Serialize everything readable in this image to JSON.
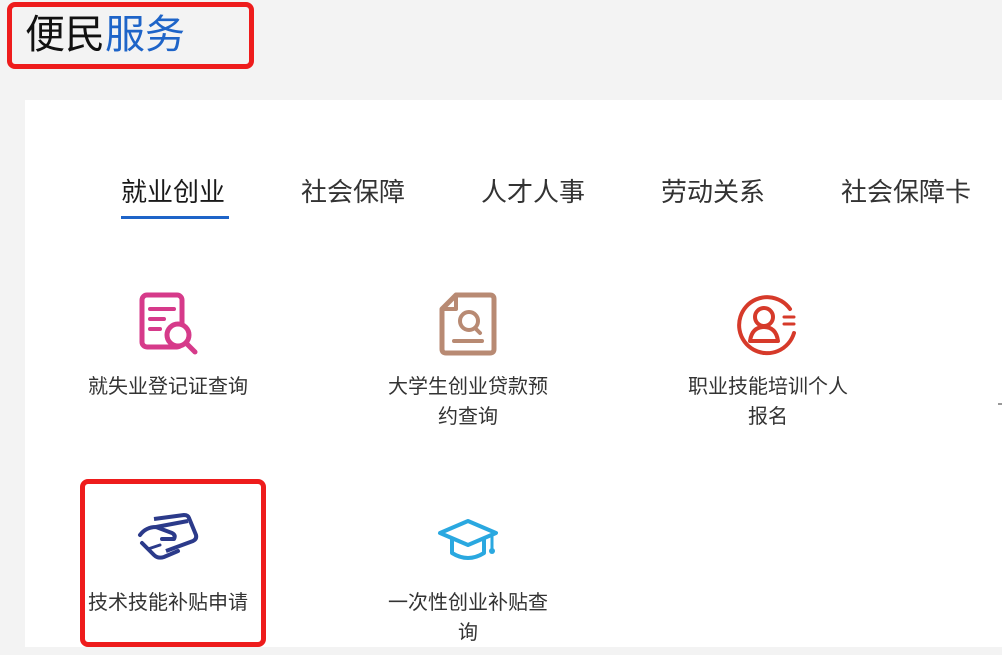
{
  "section": {
    "title_black": "便民",
    "title_blue": "服务"
  },
  "tabs": [
    {
      "label": "就业创业",
      "active": true
    },
    {
      "label": "社会保障",
      "active": false
    },
    {
      "label": "人才人事",
      "active": false
    },
    {
      "label": "劳动关系",
      "active": false
    },
    {
      "label": "社会保障卡",
      "active": false
    }
  ],
  "services": [
    {
      "label": "就失业登记证查询",
      "icon": "document-search-icon",
      "color": "#d63a8a"
    },
    {
      "label": "大学生创业贷款预约查询",
      "icon": "certificate-search-icon",
      "color": "#b88a73"
    },
    {
      "label": "职业技能培训个人报名",
      "icon": "person-list-icon",
      "color": "#d63a2a"
    },
    {
      "label": "技术技能补贴申请",
      "icon": "hand-card-icon",
      "color": "#2b3a8a"
    },
    {
      "label": "一次性创业补贴查询",
      "icon": "graduation-cap-icon",
      "color": "#2aa8e0"
    }
  ],
  "colors": {
    "accent": "#1e64c8",
    "highlight": "#ee1c1c",
    "background": "#f3f3f3",
    "panel": "#ffffff"
  }
}
